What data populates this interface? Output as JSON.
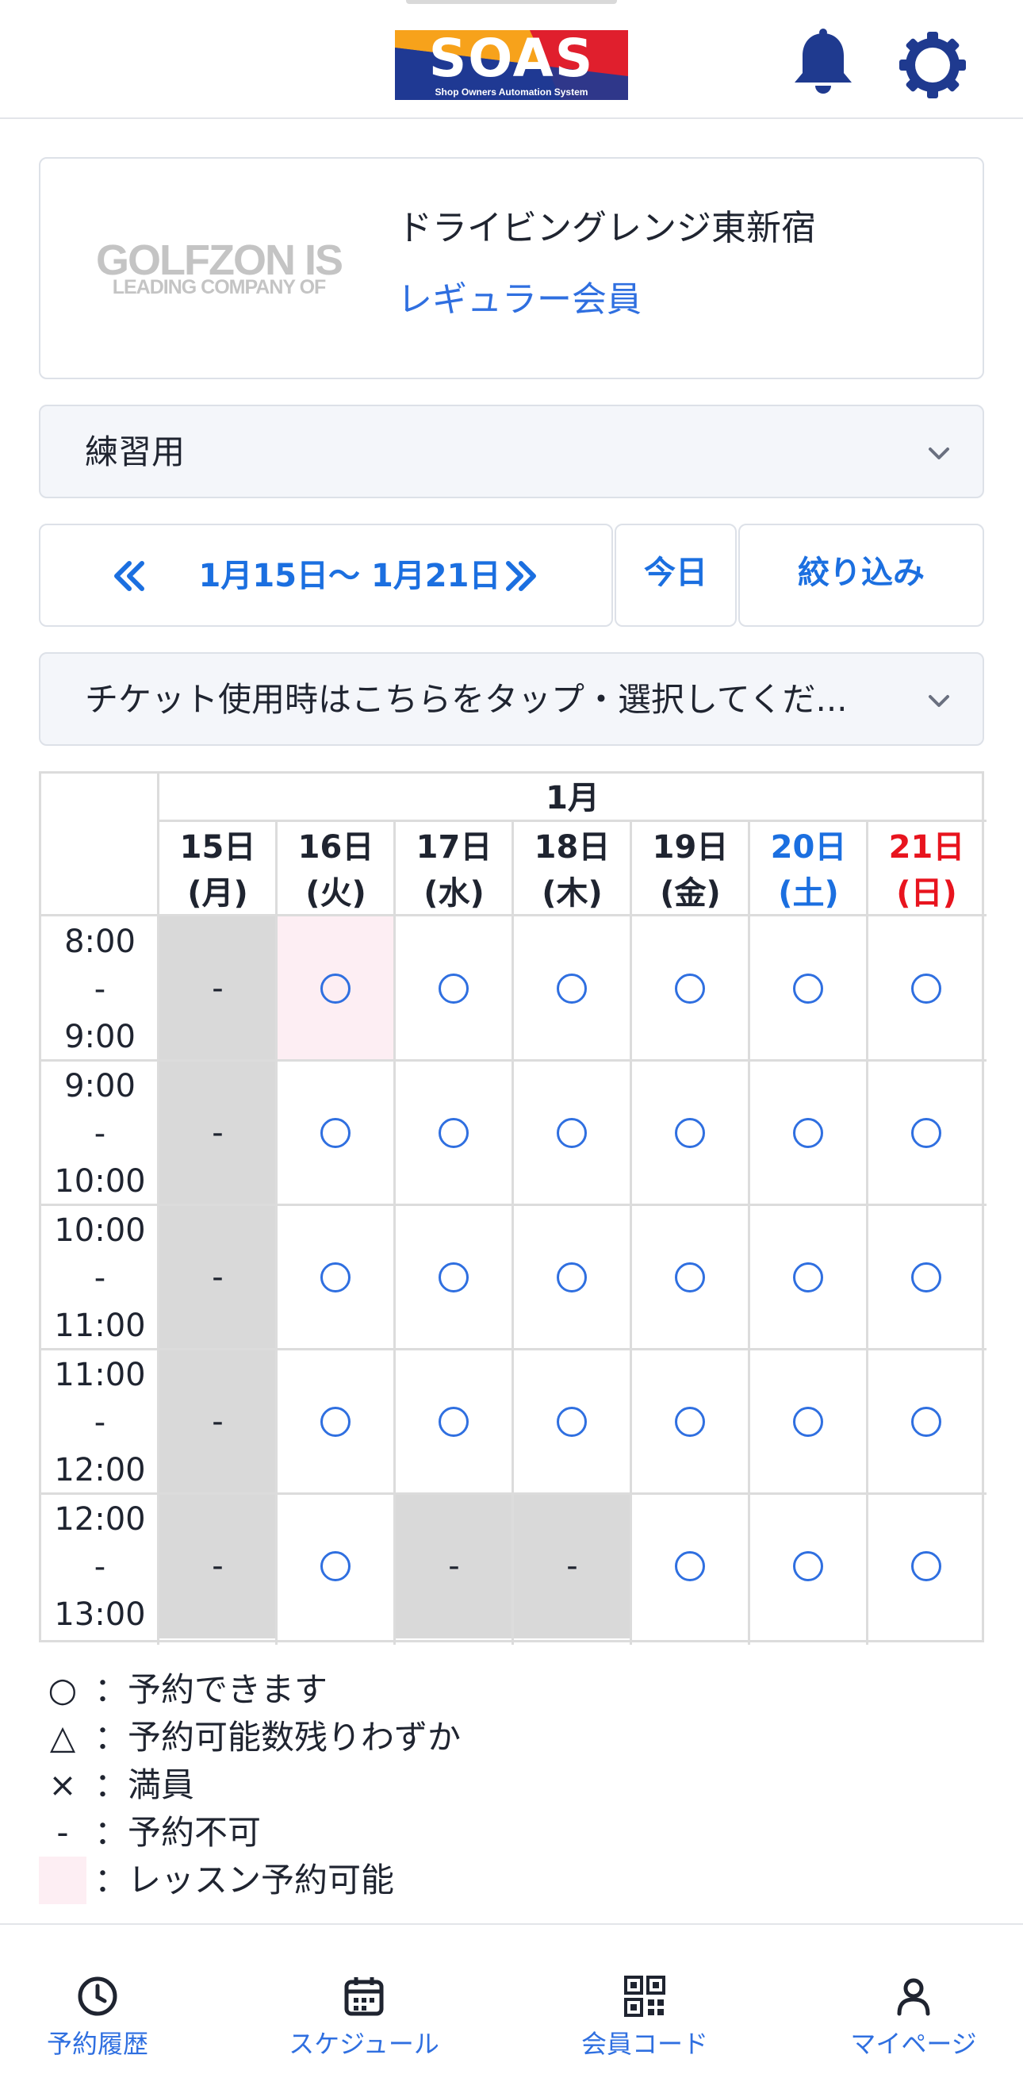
{
  "header": {
    "logo_text": "SOAS",
    "logo_subtitle": "Shop Owners Automation System",
    "icons": [
      "bell-icon",
      "gear-icon"
    ]
  },
  "store": {
    "logo_main": "GOLFZON IS",
    "logo_sub": "LEADING COMPANY OF",
    "name": "ドライビングレンジ東新宿",
    "member_type": "レギュラー会員"
  },
  "purpose_select": {
    "value": "練習用"
  },
  "date_nav": {
    "range": "1月15日〜 1月21日",
    "today_label": "今日",
    "filter_label": "絞り込み"
  },
  "ticket_select": {
    "value": "チケット使用時はこちらをタップ・選択してくだ..."
  },
  "calendar": {
    "month": "1月",
    "days": [
      {
        "date": "15日",
        "weekday": "(月)",
        "color": "#1f2430"
      },
      {
        "date": "16日",
        "weekday": "(火)",
        "color": "#1f2430"
      },
      {
        "date": "17日",
        "weekday": "(水)",
        "color": "#1f2430"
      },
      {
        "date": "18日",
        "weekday": "(木)",
        "color": "#1f2430"
      },
      {
        "date": "19日",
        "weekday": "(金)",
        "color": "#1f2430"
      },
      {
        "date": "20日",
        "weekday": "(土)",
        "color": "#1b6fe0"
      },
      {
        "date": "21日",
        "weekday": "(日)",
        "color": "#e8141e"
      }
    ],
    "slots": [
      {
        "start": "8:00",
        "sep": "-",
        "end": "9:00",
        "cells": [
          "-",
          "○",
          "○",
          "○",
          "○",
          "○",
          "○"
        ],
        "lesson": [
          false,
          true,
          false,
          false,
          false,
          false,
          false
        ]
      },
      {
        "start": "9:00",
        "sep": "-",
        "end": "10:00",
        "cells": [
          "-",
          "○",
          "○",
          "○",
          "○",
          "○",
          "○"
        ],
        "lesson": [
          false,
          false,
          false,
          false,
          false,
          false,
          false
        ]
      },
      {
        "start": "10:00",
        "sep": "-",
        "end": "11:00",
        "cells": [
          "-",
          "○",
          "○",
          "○",
          "○",
          "○",
          "○"
        ],
        "lesson": [
          false,
          false,
          false,
          false,
          false,
          false,
          false
        ]
      },
      {
        "start": "11:00",
        "sep": "-",
        "end": "12:00",
        "cells": [
          "-",
          "○",
          "○",
          "○",
          "○",
          "○",
          "○"
        ],
        "lesson": [
          false,
          false,
          false,
          false,
          false,
          false,
          false
        ]
      },
      {
        "start": "12:00",
        "sep": "-",
        "end": "13:00",
        "cells": [
          "-",
          "○",
          "-",
          "-",
          "○",
          "○",
          "○"
        ],
        "lesson": [
          false,
          false,
          false,
          false,
          false,
          false,
          false
        ]
      }
    ]
  },
  "legend": [
    {
      "symbol": "○",
      "text": "：予約できます"
    },
    {
      "symbol": "△",
      "text": "：予約可能数残りわずか"
    },
    {
      "symbol": "×",
      "text": "：満員"
    },
    {
      "symbol": "-",
      "text": "：予約不可"
    },
    {
      "symbol": "",
      "text": "：レッスン予約可能",
      "swatch": "#fdeef3"
    }
  ],
  "bottom_nav": [
    {
      "label": "予約履歴",
      "icon": "clock-icon"
    },
    {
      "label": "スケジュール",
      "icon": "calendar-icon"
    },
    {
      "label": "会員コード",
      "icon": "qr-code-icon"
    },
    {
      "label": "マイページ",
      "icon": "person-icon"
    }
  ],
  "colors": {
    "accent": "#2f6fe0",
    "saturday": "#1b6fe0",
    "sunday": "#e8141e",
    "unavailable": "#d9d9d9",
    "lesson": "#fdeef3"
  }
}
